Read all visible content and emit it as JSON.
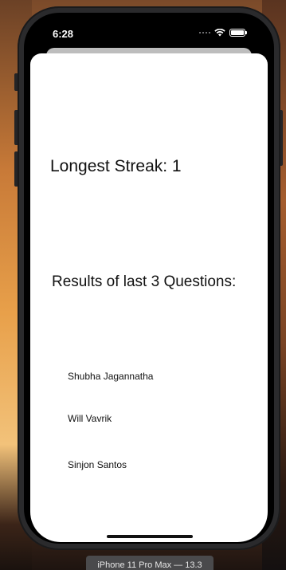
{
  "status_bar": {
    "time": "6:28",
    "icons": [
      "cellular-dots-icon",
      "wifi-icon",
      "battery-icon"
    ]
  },
  "screen": {
    "streak_text": "Longest Streak: 1",
    "results_title": "Results of last 3 Questions:",
    "results": [
      {
        "name": "Shubha Jagannatha"
      },
      {
        "name": "Will Vavrik"
      },
      {
        "name": "Sinjon Santos"
      }
    ]
  },
  "simulator": {
    "device_label": "iPhone 11 Pro Max — 13.3"
  },
  "colors": {
    "sheet_background": "#ffffff",
    "text": "#111111",
    "device_frame": "#2a2a2c"
  }
}
